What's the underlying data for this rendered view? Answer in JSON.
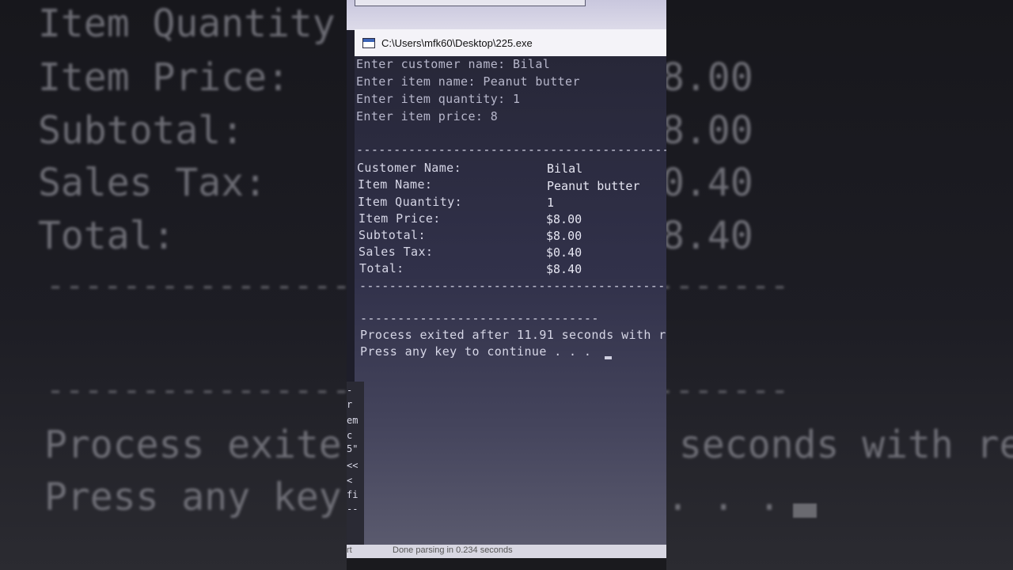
{
  "window": {
    "title": "C:\\Users\\mfk60\\Desktop\\225.exe"
  },
  "console": {
    "prompts": [
      "Enter customer name: Bilal",
      "Enter item name: Peanut butter",
      "Enter item quantity: 1",
      "Enter item price: 8"
    ],
    "separator_long": "-------------------------------------------",
    "receipt": [
      {
        "label": "Customer Name:",
        "value": "Bilal"
      },
      {
        "label": "Item Name:",
        "value": "Peanut butter"
      },
      {
        "label": "Item Quantity:",
        "value": "1"
      },
      {
        "label": "Item Price:",
        "value": "$8.00"
      },
      {
        "label": "Subtotal:",
        "value": "$8.00"
      },
      {
        "label": "Sales Tax:",
        "value": "$0.40"
      },
      {
        "label": "Total:",
        "value": "$8.40"
      }
    ],
    "separator_short": "--------------------------------",
    "process_exited": "Process exited after 11.91 seconds with re",
    "press_key": "Press any key to continue . . ."
  },
  "background_zoom": {
    "lines": [
      "Item Quantity",
      "Item Price:",
      "Subtotal:",
      "Sales Tax:",
      "Total:"
    ],
    "values": [
      "8.00",
      "8.00",
      "0.40",
      "8.40"
    ],
    "dashes": "---------------------------------------",
    "process_left": "Process exite",
    "process_right": "seconds with re",
    "press_left": "Press any key",
    "press_right": ". . ."
  },
  "editor_fragments": [
    "-",
    "r",
    "em",
    "c",
    "5\"",
    "<<",
    "<",
    "fi",
    "--"
  ],
  "statusbar": {
    "left": "rt",
    "message": "Done parsing in 0.234 seconds"
  }
}
